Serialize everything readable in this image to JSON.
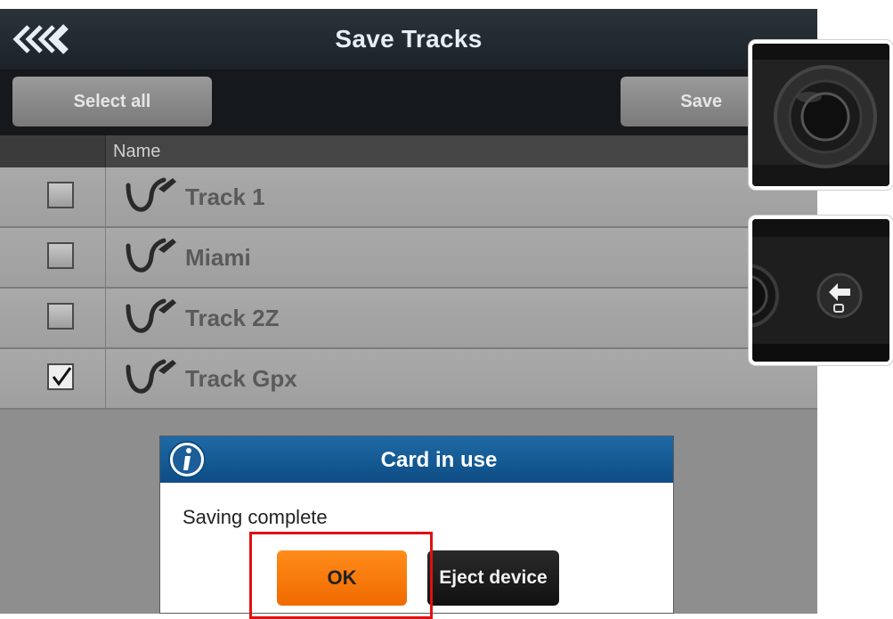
{
  "header": {
    "title": "Save Tracks",
    "back_icon": "triple-chevron-left-icon"
  },
  "toolbar": {
    "select_all_label": "Select all",
    "save_label": "Save"
  },
  "table": {
    "column_name": "Name",
    "rows": [
      {
        "name": "Track 1",
        "checked": false
      },
      {
        "name": "Miami",
        "checked": false
      },
      {
        "name": "Track 2Z",
        "checked": false
      },
      {
        "name": "Track Gpx",
        "checked": true
      }
    ]
  },
  "dialog": {
    "title": "Card in use",
    "message": "Saving complete",
    "ok_label": "OK",
    "eject_label": "Eject device",
    "icon": "info-icon"
  },
  "hardware_photos": [
    {
      "name": "rotary-joystick-photo"
    },
    {
      "name": "back-button-photo"
    }
  ],
  "colors": {
    "titlebar": "#1c2228",
    "dialog_header": "#1e6aa6",
    "ok_button": "#f47a00",
    "highlight": "#e01010"
  }
}
